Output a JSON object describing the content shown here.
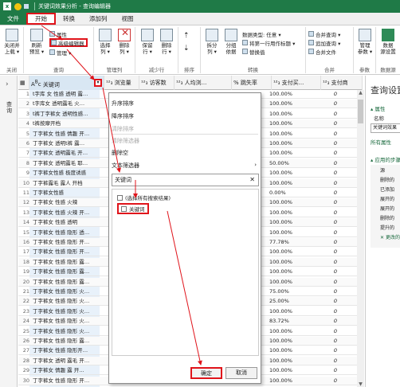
{
  "window": {
    "title": "关键词效果分析 - 查询编辑器"
  },
  "menu": {
    "file": "文件",
    "tabs": [
      "开始",
      "转换",
      "添加列",
      "视图"
    ]
  },
  "ribbon": {
    "close": {
      "label": "关闭并\n上载 ▾",
      "group": "关闭"
    },
    "query": {
      "refresh": "刷新\n预览 ▾",
      "properties": "属性",
      "advanced_editor": "高级编辑器",
      "manage": "管理 ▾",
      "group": "查询"
    },
    "manage_cols": {
      "choose": "选择\n列 ▾",
      "remove": "删除\n列 ▾",
      "group": "管理列"
    },
    "reduce_rows": {
      "keep": "保留\n行 ▾",
      "remove": "删除\n行 ▾",
      "group": "减少行"
    },
    "sort": {
      "group": "排序"
    },
    "transform": {
      "split": "拆分\n列 ▾",
      "group_by": "分组\n依据",
      "data_type": "数据类型: 任意 ▾",
      "first_row": "将第一行用作标题 ▾",
      "replace": "替换值",
      "group": "转换"
    },
    "combine": {
      "merge": "合并查询 ▾",
      "append": "追加查询 ▾",
      "merge_files": "合并文件",
      "group": "合并"
    },
    "params": {
      "manage": "管理\n参数 ▾",
      "group": "参数"
    },
    "datasource": {
      "settings": "数据\n源设置",
      "group": "数据源"
    }
  },
  "left_panel": {
    "label": "查询"
  },
  "grid": {
    "headers": [
      "关键词",
      "浏览量",
      "访客数",
      "人均浏...",
      "% 跳失率",
      "支付买...",
      "支付商"
    ],
    "rows": [
      {
        "n": "1",
        "kw": "t字库 女 性感 透明 露…",
        "pct": "100.00%",
        "z": "0"
      },
      {
        "n": "2",
        "kw": "t字库女 透明露毛 火…",
        "pct": "100.00%",
        "z": "0"
      },
      {
        "n": "3",
        "kw": "t裤丁字裤女 透明性感…",
        "pct": "100.00%",
        "z": "0"
      },
      {
        "n": "4",
        "kw": "t裤按摩开档",
        "pct": "100.00%",
        "z": "0"
      },
      {
        "n": "5",
        "kw": "丁字裤女 性感 情趣 开…",
        "pct": "100.00%",
        "z": "0"
      },
      {
        "n": "6",
        "kw": "丁字裤女 透明t裤 露…",
        "pct": "100.00%",
        "z": "0"
      },
      {
        "n": "7",
        "kw": "丁字裤女 透明露毛 开…",
        "pct": "100.00%",
        "z": "0"
      },
      {
        "n": "8",
        "kw": "丁字裤女 透明露毛 耶…",
        "pct": "50.00%",
        "z": "0"
      },
      {
        "n": "9",
        "kw": "丁字裤女性感 极度诱惑",
        "pct": "100.00%",
        "z": "0"
      },
      {
        "n": "10",
        "kw": "丁字裤露毛 露人 开档",
        "pct": "100.00%",
        "z": "0"
      },
      {
        "n": "11",
        "kw": "丁字裤女性感",
        "pct": "0.00%",
        "z": "0"
      },
      {
        "n": "12",
        "kw": "丁字裤女 性感 火辣",
        "pct": "100.00%",
        "z": "0"
      },
      {
        "n": "13",
        "kw": "丁字裤女 性感 火辣 开…",
        "pct": "100.00%",
        "z": "0"
      },
      {
        "n": "14",
        "kw": "丁字裤女 性感 透明",
        "pct": "100.00%",
        "z": "0"
      },
      {
        "n": "15",
        "kw": "丁字裤女 性感 隐形 透…",
        "pct": "100.00%",
        "z": "0"
      },
      {
        "n": "16",
        "kw": "丁字裤女 性感 隐形 开…",
        "pct": "77.78%",
        "z": "0"
      },
      {
        "n": "17",
        "kw": "丁字裤女 性感 隐形 开…",
        "pct": "100.00%",
        "z": "0"
      },
      {
        "n": "18",
        "kw": "丁字裤女 性感 隐形 露…",
        "pct": "100.00%",
        "z": "0"
      },
      {
        "n": "19",
        "kw": "丁字裤女 性感 隐形 露…",
        "pct": "100.00%",
        "z": "0"
      },
      {
        "n": "20",
        "kw": "丁字裤女 性感 隐形 露…",
        "pct": "100.00%",
        "z": "0"
      },
      {
        "n": "21",
        "kw": "丁字裤女 性感 隐形 火…",
        "pct": "75.00%",
        "z": "0"
      },
      {
        "n": "22",
        "kw": "丁字裤女 性感 隐形 火…",
        "pct": "25.00%",
        "z": "0"
      },
      {
        "n": "23",
        "kw": "丁字裤女 性感 隐形 火…",
        "pct": "100.00%",
        "z": "0"
      },
      {
        "n": "24",
        "kw": "丁字裤女 性感 隐形 火…",
        "pct": "83.72%",
        "z": "0"
      },
      {
        "n": "25",
        "kw": "丁字裤女 性感 隐形 火…",
        "pct": "100.00%",
        "z": "0"
      },
      {
        "n": "26",
        "kw": "丁字裤女 性感 隐形 露…",
        "pct": "100.00%",
        "z": "0"
      },
      {
        "n": "27",
        "kw": "丁字裤女 性感 隐形开…",
        "pct": "100.00%",
        "z": "0"
      },
      {
        "n": "28",
        "kw": "丁字裤女 透明 露毛 开…",
        "pct": "100.00%",
        "z": "0"
      },
      {
        "n": "29",
        "kw": "丁字裤女 情趣 露 开…",
        "pct": "100.00%",
        "z": "0"
      },
      {
        "n": "30",
        "kw": "丁字裤女 性感 隐形 开…",
        "pct": "100.00%",
        "z": "0"
      }
    ]
  },
  "dropdown": {
    "sort_asc": "升序排序",
    "sort_desc": "降序排序",
    "clear_sort": "清除排序",
    "clear_filter": "清除筛选器",
    "remove_empty": "删除空",
    "text_filters": "文本筛选器",
    "search_value": "关键词",
    "select_all": "(选择所有搜索结果)",
    "option_keyword": "关键词",
    "ok": "确定",
    "cancel": "取消"
  },
  "right_panel": {
    "title": "查询设置",
    "properties": "▴ 属性",
    "name_label": "名称",
    "name_value": "关键词效果",
    "all_props": "所有属性",
    "applied_steps": "▴ 应用的步骤",
    "steps": [
      "源",
      "删除的",
      "已添加",
      "展开的",
      "展开的",
      "删除的",
      "提升的",
      "更改的"
    ]
  }
}
